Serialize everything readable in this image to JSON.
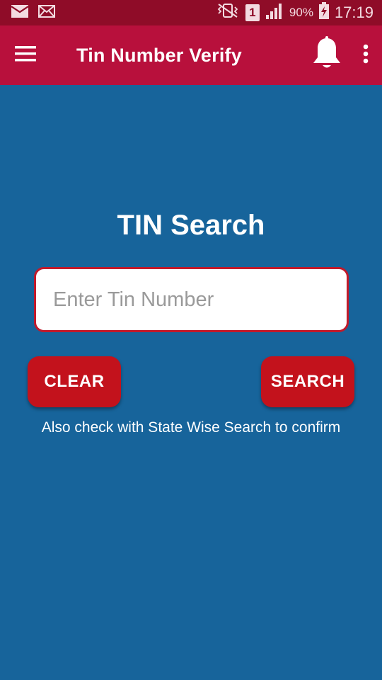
{
  "status_bar": {
    "icons": [
      "email-icon",
      "mail-icon",
      "vibrate-icon",
      "sim-icon",
      "signal-icon",
      "battery-charging-icon"
    ],
    "sim_label": "1",
    "battery": "90%",
    "time": "17:19"
  },
  "app_bar": {
    "title": "Tin Number Verify",
    "icons": [
      "menu-icon",
      "bell-icon",
      "more-vert-icon"
    ]
  },
  "main": {
    "heading": "TIN Search",
    "input": {
      "placeholder": "Enter Tin Number",
      "value": ""
    },
    "clear_label": "CLEAR",
    "search_label": "SEARCH",
    "hint": "Also check with State Wise Search to confirm"
  },
  "colors": {
    "status_bar": "#8f0c28",
    "app_bar": "#b8103c",
    "background": "#17649b",
    "button": "#c3121c",
    "input_border": "#c11a2b"
  }
}
